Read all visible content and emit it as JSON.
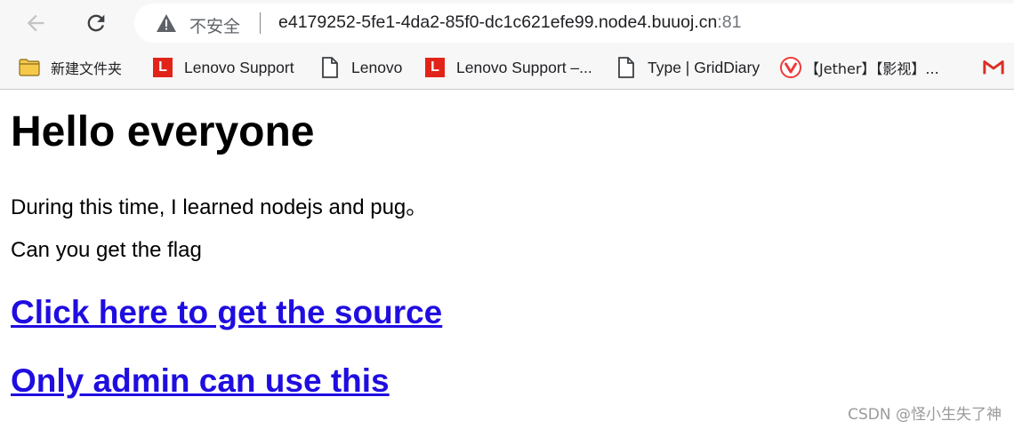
{
  "address_bar": {
    "security_label": "不安全",
    "url_host": "e4179252-5fe1-4da2-85f0-dc1c621efe99.node4.buuoj.cn",
    "url_port": ":81"
  },
  "bookmarks": [
    {
      "label": "新建文件夹",
      "icon": "folder-icon"
    },
    {
      "label": "Lenovo Support",
      "icon": "lenovo-icon"
    },
    {
      "label": "Lenovo",
      "icon": "page-icon"
    },
    {
      "label": "Lenovo Support –...",
      "icon": "lenovo-icon"
    },
    {
      "label": "Type | GridDiary",
      "icon": "page-icon"
    },
    {
      "label": "【Jether】【影视】...",
      "icon": "vivaldi-icon"
    },
    {
      "label": "",
      "icon": "gmail-icon"
    }
  ],
  "page": {
    "heading": "Hello everyone",
    "paragraph1": "During this time, I learned nodejs and pug。",
    "paragraph2": "Can you get the flag",
    "link_source": "Click here to get the source",
    "link_admin": "Only admin can use this"
  },
  "watermark": "CSDN @怪小生失了神",
  "colors": {
    "link": "#1f0de0",
    "toolbar_bg": "#f7f7f7",
    "lenovo_red": "#e2231a"
  }
}
